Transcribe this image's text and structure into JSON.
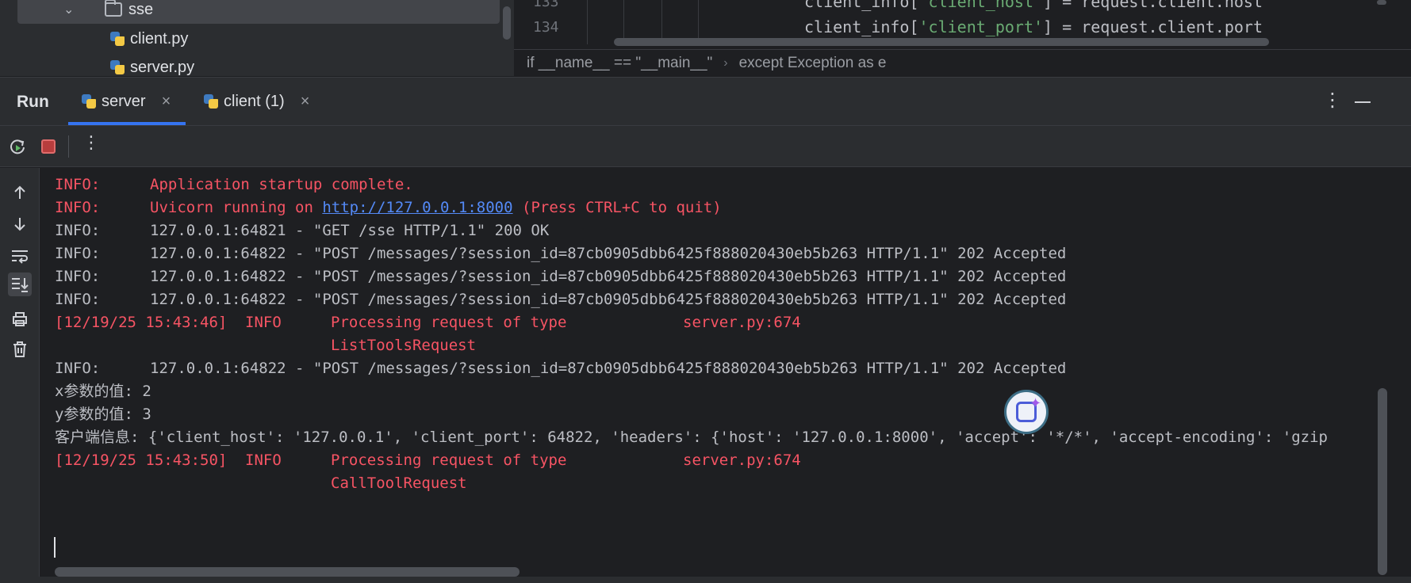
{
  "project_tree": {
    "folder": "sse",
    "files": [
      "client.py",
      "server.py"
    ]
  },
  "editor": {
    "lines": [
      {
        "num": "133",
        "pre": "client_info[",
        "key": "'client_host'",
        "post": "] = request.client.host"
      },
      {
        "num": "134",
        "pre": "client_info[",
        "key": "'client_port'",
        "post": "] = request.client.port"
      }
    ],
    "breadcrumb": [
      "if __name__ == \"__main__\"",
      "except Exception as e"
    ]
  },
  "run_window": {
    "title": "Run",
    "tabs": [
      {
        "label": "server",
        "active": true
      },
      {
        "label": "client (1)",
        "active": false
      }
    ]
  },
  "console": {
    "lines": [
      {
        "type": "info_red",
        "level": "INFO:",
        "message": "Application startup complete."
      },
      {
        "type": "info_red_link",
        "level": "INFO:",
        "message_before": "Uvicorn running on ",
        "link": "http://127.0.0.1:8000",
        "message_after": " (Press CTRL+C to quit)"
      },
      {
        "type": "info_plain",
        "level": "INFO:",
        "message": "127.0.0.1:64821 - \"GET /sse HTTP/1.1\" 200 OK"
      },
      {
        "type": "info_plain",
        "level": "INFO:",
        "message": "127.0.0.1:64822 - \"POST /messages/?session_id=87cb0905dbb6425f888020430eb5b263 HTTP/1.1\" 202 Accepted"
      },
      {
        "type": "info_plain",
        "level": "INFO:",
        "message": "127.0.0.1:64822 - \"POST /messages/?session_id=87cb0905dbb6425f888020430eb5b263 HTTP/1.1\" 202 Accepted"
      },
      {
        "type": "info_plain",
        "level": "INFO:",
        "message": "127.0.0.1:64822 - \"POST /messages/?session_id=87cb0905dbb6425f888020430eb5b263 HTTP/1.1\" 202 Accepted"
      },
      {
        "type": "log",
        "timestamp": "[12/19/25 15:43:46]",
        "level": "INFO",
        "message": "Processing request of type",
        "source": "server.py:674"
      },
      {
        "type": "log_cont",
        "message": "ListToolsRequest"
      },
      {
        "type": "info_plain",
        "level": "INFO:",
        "message": "127.0.0.1:64822 - \"POST /messages/?session_id=87cb0905dbb6425f888020430eb5b263 HTTP/1.1\" 202 Accepted"
      },
      {
        "type": "plain",
        "message": "x参数的值: 2"
      },
      {
        "type": "plain",
        "message": "y参数的值: 3"
      },
      {
        "type": "plain",
        "message": "客户端信息: {'client_host': '127.0.0.1', 'client_port': 64822, 'headers': {'host': '127.0.0.1:8000', 'accept': '*/*', 'accept-encoding': 'gzip"
      },
      {
        "type": "log",
        "timestamp": "[12/19/25 15:43:50]",
        "level": "INFO",
        "message": "Processing request of type",
        "source": "server.py:674"
      },
      {
        "type": "log_cont",
        "message": "CallToolRequest"
      }
    ]
  },
  "icons": {
    "side_toolbar": [
      "arrow-up-icon",
      "arrow-down-icon",
      "soft-wrap-icon",
      "scroll-to-end-icon",
      "print-icon",
      "trash-icon"
    ],
    "run_toolbar": [
      "rerun-icon",
      "stop-icon",
      "more-vertical-icon"
    ]
  },
  "colors": {
    "error_red": "#f75464",
    "link_blue": "#548af7",
    "accent": "#3574f0",
    "string_green": "#6aab73"
  }
}
